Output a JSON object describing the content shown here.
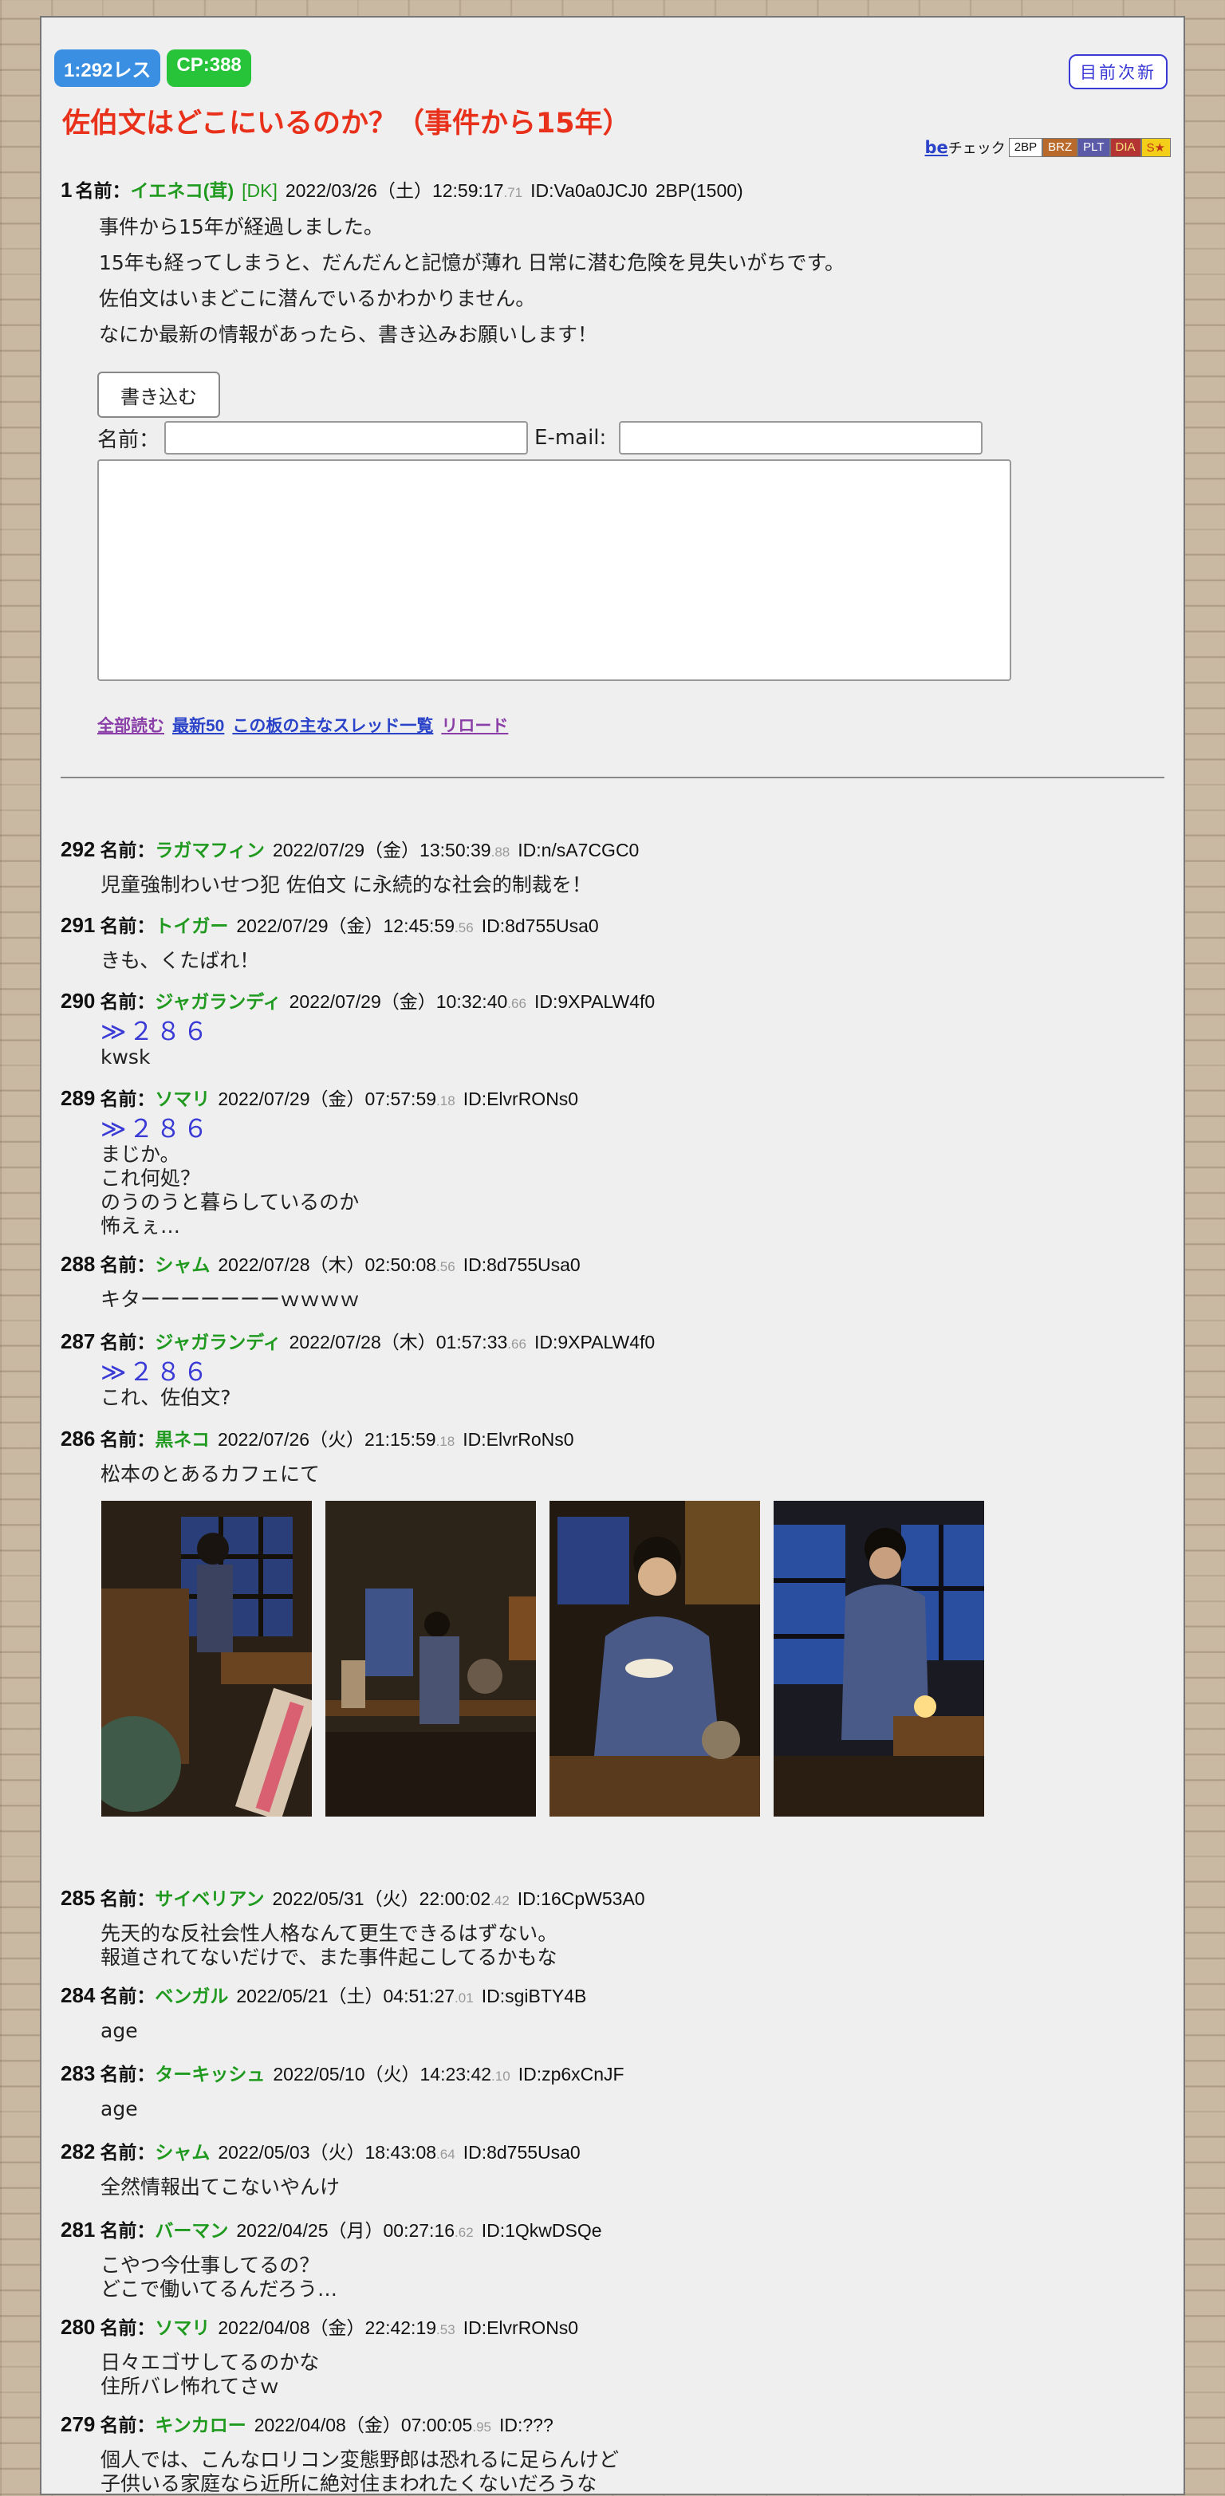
{
  "thread": {
    "count_badge": "1:292レス",
    "cp_badge": "CP:388",
    "nav_label": "目前次新",
    "title": "佐伯文はどこにいるのか？（事件から15年）",
    "be_link": "be",
    "be_check": "チェック",
    "be_tags": [
      {
        "label": "2BP",
        "bg": "#ffffff",
        "fg": "#111111"
      },
      {
        "label": "BRZ",
        "bg": "#b96a2a",
        "fg": "#ffffff"
      },
      {
        "label": "PLT",
        "bg": "#5a5aa8",
        "fg": "#ffffff"
      },
      {
        "label": "DIA",
        "bg": "#b43434",
        "fg": "#ffe07a"
      },
      {
        "label": "S★",
        "bg": "#f3cf1a",
        "fg": "#c0341a"
      }
    ]
  },
  "op": {
    "num": "1",
    "label": "名前：",
    "name": "イエネコ(茸)",
    "tag": "[DK]",
    "date": "2022/03/26（土）12:59:17",
    "ms": ".71",
    "id": "ID:Va0a0JCJ0",
    "bp": "2BP(1500)",
    "lines": [
      "事件から15年が経過しました。",
      "15年も経ってしまうと、だんだんと記憶が薄れ 日常に潜む危険を見失いがちです。",
      "佐伯文はいまどこに潜んでいるかわかりません。",
      "なにか最新の情報があったら、書き込みお願いします！"
    ]
  },
  "form": {
    "write_button": "書き込む",
    "name_label": "名前：",
    "email_label": "E-mail:"
  },
  "links": [
    "全部読む",
    "最新50",
    "この板の主なスレッド一覧",
    "リロード"
  ],
  "replies": [
    {
      "num": "292",
      "name": "ラガマフィン",
      "date": "2022/07/29（金）13:50:39",
      "ms": ".88",
      "id": "ID:n/sA7CGC0",
      "anchor": "",
      "lines": [
        "児童強制わいせつ犯 佐伯文 に永続的な社会的制裁を！"
      ]
    },
    {
      "num": "291",
      "name": "トイガー",
      "date": "2022/07/29（金）12:45:59",
      "ms": ".56",
      "id": "ID:8d755Usa0",
      "anchor": "",
      "lines": [
        "きも、くたばれ！"
      ]
    },
    {
      "num": "290",
      "name": "ジャガランディ",
      "date": "2022/07/29（金）10:32:40",
      "ms": ".66",
      "id": "ID:9XPALW4f0",
      "anchor": "≫２８６",
      "lines": [
        "kwsk"
      ]
    },
    {
      "num": "289",
      "name": "ソマリ",
      "date": "2022/07/29（金）07:57:59",
      "ms": ".18",
      "id": "ID:ElvrRONs0",
      "anchor": "≫２８６",
      "lines": [
        "まじか。",
        "これ何処？",
        "のうのうと暮らしているのか",
        "怖えぇ…"
      ]
    },
    {
      "num": "288",
      "name": "シャム",
      "date": "2022/07/28（木）02:50:08",
      "ms": ".56",
      "id": "ID:8d755Usa0",
      "anchor": "",
      "lines": [
        "キターーーーーーーｗｗｗｗ"
      ]
    },
    {
      "num": "287",
      "name": "ジャガランディ",
      "date": "2022/07/28（木）01:57:33",
      "ms": ".66",
      "id": "ID:9XPALW4f0",
      "anchor": "≫２８６",
      "lines": [
        "これ、佐伯文?"
      ]
    },
    {
      "num": "286",
      "name": "黒ネコ",
      "date": "2022/07/26（火）21:15:59",
      "ms": ".18",
      "id": "ID:ElvrRoNs0",
      "anchor": "",
      "lines": [
        "松本のとあるカフェにて"
      ]
    },
    {
      "num": "285",
      "name": "サイベリアン",
      "date": "2022/05/31（火）22:00:02",
      "ms": ".42",
      "id": "ID:16CpW53A0",
      "anchor": "",
      "lines": [
        "先天的な反社会性人格なんて更生できるはずない。",
        "報道されてないだけで、また事件起こしてるかもな"
      ]
    },
    {
      "num": "284",
      "name": "ベンガル",
      "date": "2022/05/21（土）04:51:27",
      "ms": ".01",
      "id": "ID:sgiBTY4B",
      "anchor": "",
      "lines": [
        "age"
      ]
    },
    {
      "num": "283",
      "name": "ターキッシュ",
      "date": "2022/05/10（火）14:23:42",
      "ms": ".10",
      "id": "ID:zp6xCnJF",
      "anchor": "",
      "lines": [
        "age"
      ]
    },
    {
      "num": "282",
      "name": "シャム",
      "date": "2022/05/03（火）18:43:08",
      "ms": ".64",
      "id": "ID:8d755Usa0",
      "anchor": "",
      "lines": [
        "全然情報出てこないやんけ"
      ]
    },
    {
      "num": "281",
      "name": "バーマン",
      "date": "2022/04/25（月）00:27:16",
      "ms": ".62",
      "id": "ID:1QkwDSQe",
      "anchor": "",
      "lines": [
        "こやつ今仕事してるの？",
        "どこで働いてるんだろう…"
      ]
    },
    {
      "num": "280",
      "name": "ソマリ",
      "date": "2022/04/08（金）22:42:19",
      "ms": ".53",
      "id": "ID:ElvrRONs0",
      "anchor": "",
      "lines": [
        "日々エゴサしてるのかな",
        "住所バレ怖れてさｗ"
      ]
    },
    {
      "num": "279",
      "name": "キンカロー",
      "date": "2022/04/08（金）07:00:05",
      "ms": ".95",
      "id": "ID:???",
      "anchor": "",
      "lines": [
        "個人では、こんなロリコン変態野郎は恐れるに足らんけど",
        "子供いる家庭なら近所に絶対住まわれたくないだろうな"
      ]
    }
  ],
  "reply_label": "名前：",
  "photos": [
    {
      "icon": "cafe-photo"
    },
    {
      "icon": "cafe-photo"
    },
    {
      "icon": "cafe-photo"
    },
    {
      "icon": "cafe-photo"
    }
  ]
}
